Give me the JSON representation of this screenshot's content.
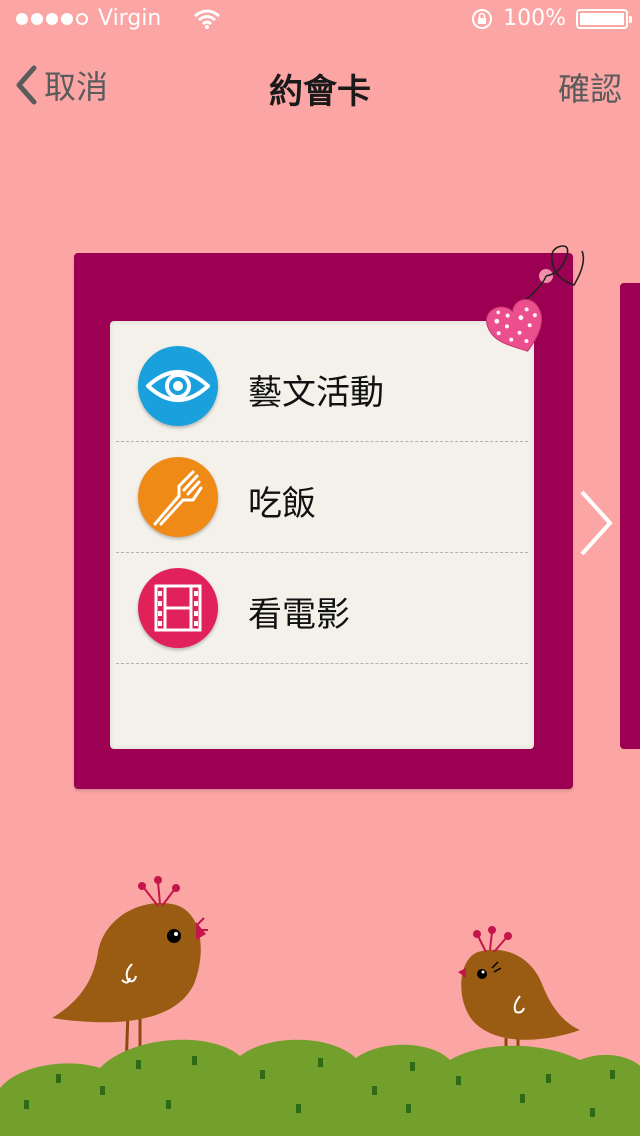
{
  "status_bar": {
    "carrier": "Virgin",
    "battery_percent": "100%",
    "signal_bars_filled": 4,
    "signal_bars_total": 5,
    "wifi_icon": "wifi-icon",
    "orientation_lock_icon": "orientation-lock-icon",
    "battery_level": 1.0
  },
  "nav": {
    "back_label": "取消",
    "title": "約會卡",
    "confirm_label": "確認"
  },
  "card": {
    "items": [
      {
        "label": "藝文活動",
        "icon": "eye-icon",
        "color": "#1aa0dc"
      },
      {
        "label": "吃飯",
        "icon": "fork-icon",
        "color": "#ef8a16"
      },
      {
        "label": "看電影",
        "icon": "film-icon",
        "color": "#e0215a"
      }
    ]
  },
  "colors": {
    "background": "#fca5a5",
    "card_frame": "#9c0052",
    "card_paper": "#f3f1ea",
    "grass": "#73a02c",
    "bird": "#9a5b12"
  }
}
